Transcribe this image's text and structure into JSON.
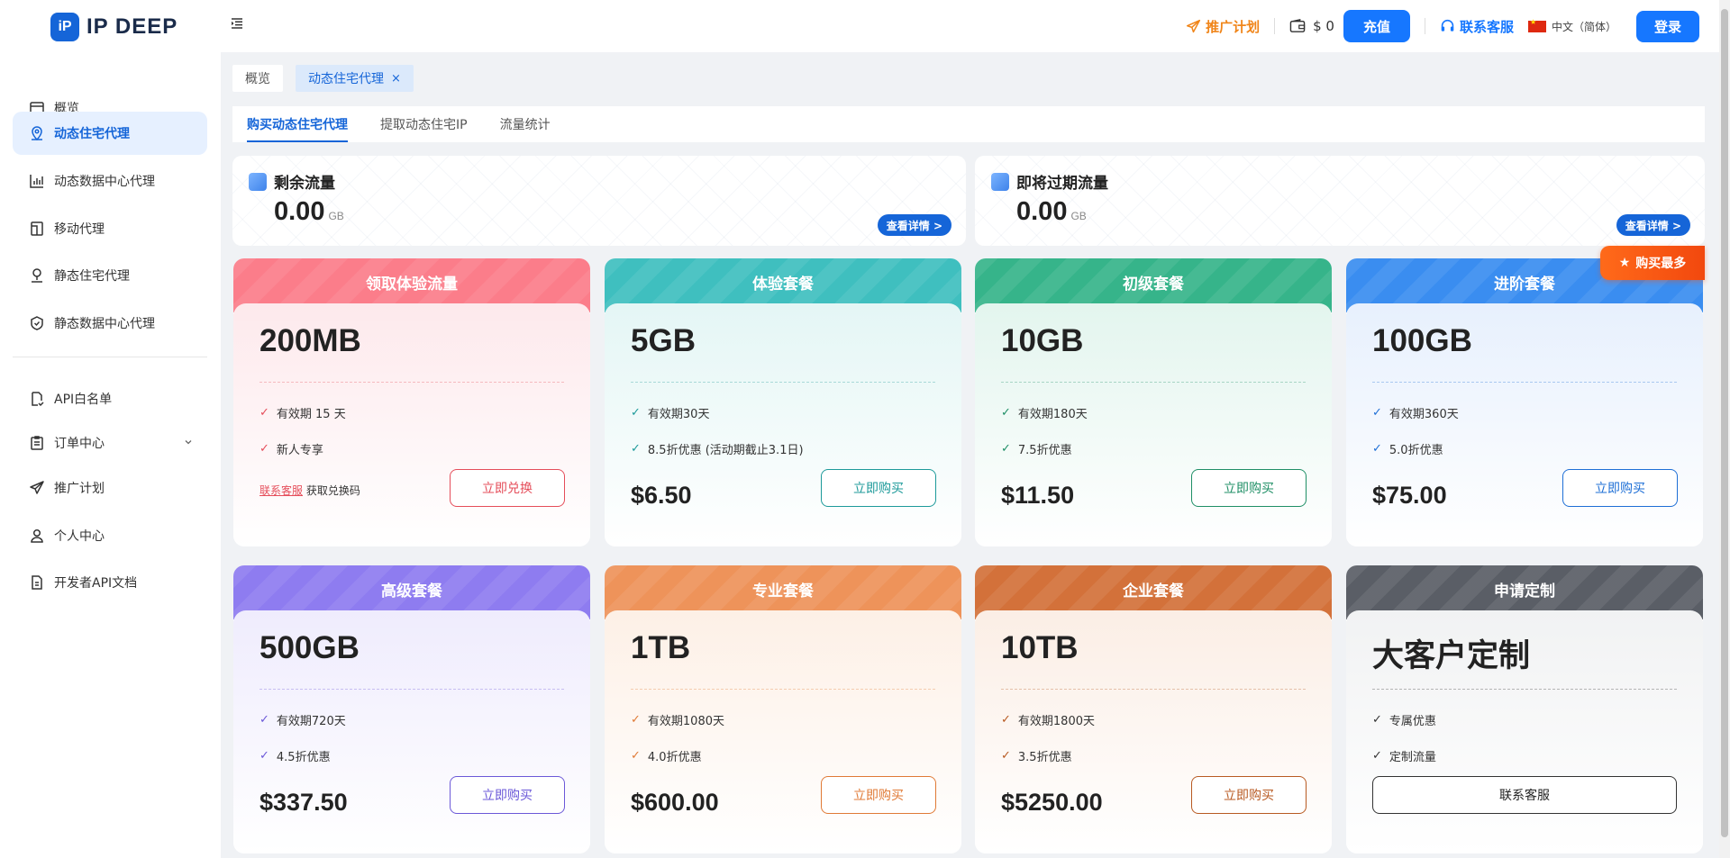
{
  "header": {
    "logo_mark": "iP",
    "logo_text": "IP DEEP",
    "promo_label": "推广计划",
    "balance": "$ 0",
    "recharge_label": "充值",
    "support_label": "联系客服",
    "language": "中文（简体）",
    "login_label": "登录"
  },
  "sidebar": {
    "items": [
      {
        "label": "概览",
        "icon": "dashboard-icon"
      },
      {
        "label": "动态住宅代理",
        "icon": "location-icon"
      },
      {
        "label": "动态数据中心代理",
        "icon": "datacenter-icon"
      },
      {
        "label": "移动代理",
        "icon": "mobile-icon"
      },
      {
        "label": "静态住宅代理",
        "icon": "pin-icon"
      },
      {
        "label": "静态数据中心代理",
        "icon": "shield-icon"
      },
      {
        "label": "API白名单",
        "icon": "document-check-icon"
      },
      {
        "label": "订单中心",
        "icon": "clipboard-icon"
      },
      {
        "label": "推广计划",
        "icon": "send-icon"
      },
      {
        "label": "个人中心",
        "icon": "user-icon"
      },
      {
        "label": "开发者API文档",
        "icon": "file-icon"
      }
    ]
  },
  "tabs": {
    "overview": "概览",
    "current": "动态住宅代理",
    "close": "×"
  },
  "subtabs": [
    "购买动态住宅代理",
    "提取动态住宅IP",
    "流量统计"
  ],
  "flow": {
    "remaining": {
      "title": "剩余流量",
      "value": "0.00",
      "unit": "GB",
      "button": "查看详情 >"
    },
    "expiring": {
      "title": "即将过期流量",
      "value": "0.00",
      "unit": "GB",
      "button": "查看详情 >"
    }
  },
  "badge": "购买最多",
  "colors": {
    "accent": "#1677ff",
    "promo": "#f08519"
  },
  "cards": [
    {
      "title": "领取体验流量",
      "size": "200MB",
      "features": [
        "有效期 15 天",
        "新人专享"
      ],
      "price": "",
      "button": "立即兑换",
      "redeem_link": "联系客服",
      "redeem_text": "获取兑换码",
      "head_color": "#fb7d8a",
      "body_tint": "#fde9ec",
      "accent": "#e54d5a"
    },
    {
      "title": "体验套餐",
      "size": "5GB",
      "features": [
        "有效期30天",
        "8.5折优惠 (活动期截止3.1日)"
      ],
      "price": "$6.50",
      "button": "立即购买",
      "head_color": "#3fbfbf",
      "body_tint": "#e4f6f5",
      "accent": "#1d9a9a"
    },
    {
      "title": "初级套餐",
      "size": "10GB",
      "features": [
        "有效期180天",
        "7.5折优惠"
      ],
      "price": "$11.50",
      "button": "立即购买",
      "head_color": "#36b48a",
      "body_tint": "#e3f5ee",
      "accent": "#1f8f66"
    },
    {
      "title": "进阶套餐",
      "size": "100GB",
      "features": [
        "有效期360天",
        "5.0折优惠"
      ],
      "price": "$75.00",
      "button": "立即购买",
      "head_color": "#3a8df0",
      "body_tint": "#e7f0fd",
      "accent": "#1e6fd6"
    },
    {
      "title": "高级套餐",
      "size": "500GB",
      "features": [
        "有效期720天",
        "4.5折优惠"
      ],
      "price": "$337.50",
      "button": "立即购买",
      "head_color": "#8e7cf0",
      "body_tint": "#efecfd",
      "accent": "#6b58d8"
    },
    {
      "title": "专业套餐",
      "size": "1TB",
      "features": [
        "有效期1080天",
        "4.0折优惠"
      ],
      "price": "$600.00",
      "button": "立即购买",
      "head_color": "#ee935a",
      "body_tint": "#fdf0e6",
      "accent": "#e07a36"
    },
    {
      "title": "企业套餐",
      "size": "10TB",
      "features": [
        "有效期1800天",
        "3.5折优惠"
      ],
      "price": "$5250.00",
      "button": "立即购买",
      "head_color": "#d3713a",
      "body_tint": "#fbeee5",
      "accent": "#b85a22"
    },
    {
      "title": "申请定制",
      "size": "大客户定制",
      "features": [
        "专属优惠",
        "定制流量"
      ],
      "price": "",
      "button": "联系客服",
      "head_color": "#5a5e66",
      "body_tint": "#f1f2f3",
      "accent": "#333333"
    }
  ]
}
